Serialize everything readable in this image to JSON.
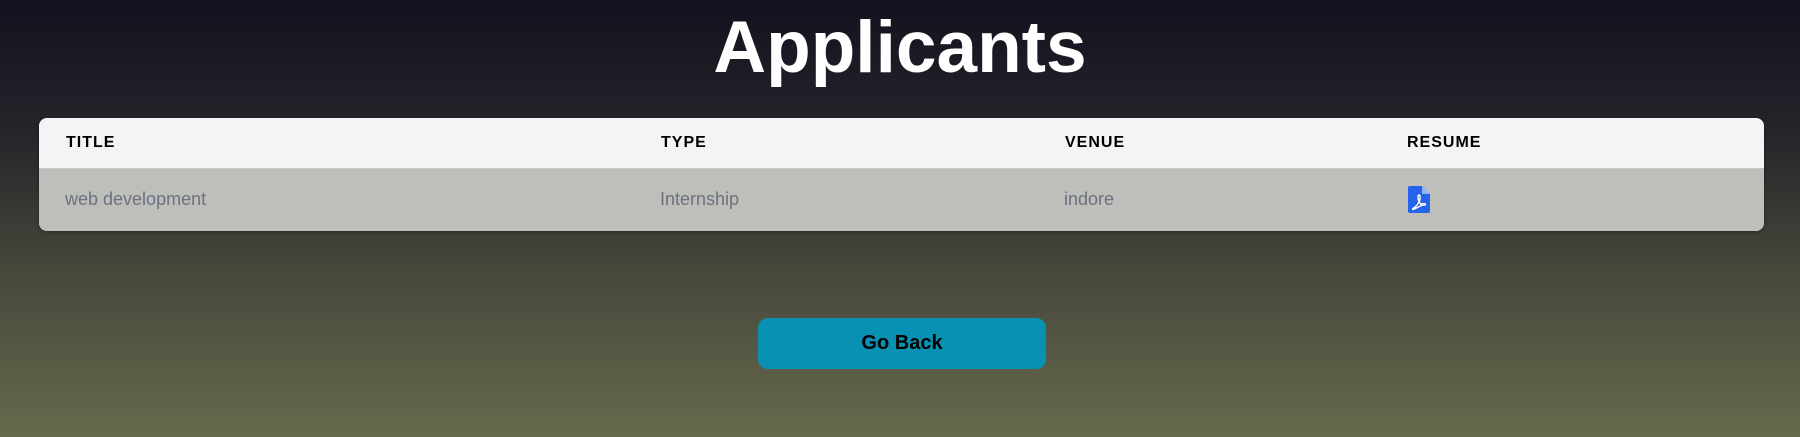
{
  "page": {
    "title": "Applicants"
  },
  "table": {
    "columns": [
      "TITLE",
      "TYPE",
      "VENUE",
      "RESUME"
    ],
    "rows": [
      {
        "title": "web development",
        "type": "Internship",
        "venue": "indore",
        "resume_icon": "pdf-file-icon"
      }
    ]
  },
  "actions": {
    "go_back_label": "Go Back"
  },
  "colors": {
    "accent": "#0891b2",
    "pdf_icon": "#2563eb"
  }
}
